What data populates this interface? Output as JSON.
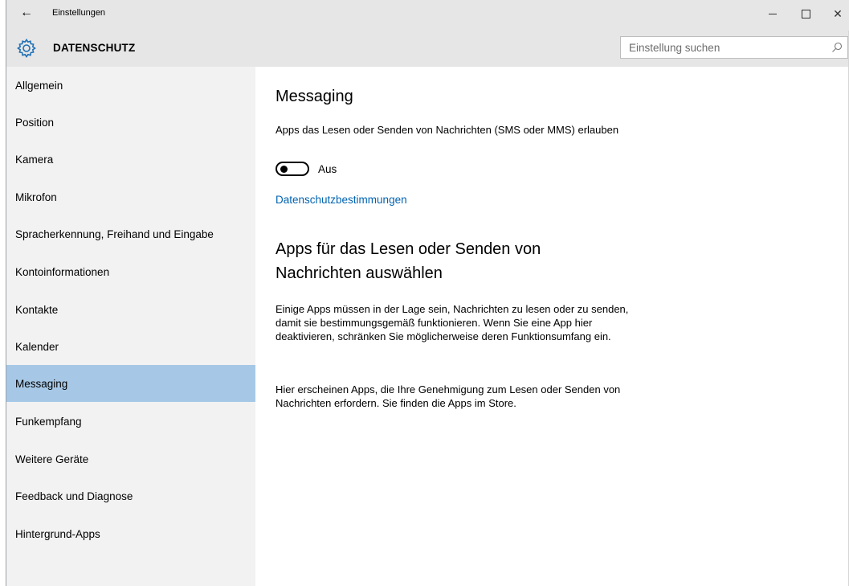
{
  "window": {
    "title": "Einstellungen",
    "back_icon": "arrow-left-icon",
    "controls": [
      "minimize-icon",
      "maximize-icon",
      "close-icon"
    ],
    "close_glyph": "✕",
    "back_glyph": "←"
  },
  "header": {
    "icon": "gear-icon",
    "title": "DATENSCHUTZ",
    "search": {
      "placeholder": "Einstellung suchen",
      "value": "",
      "icon": "search-icon"
    }
  },
  "sidebar": {
    "selected_index": 8,
    "items": [
      {
        "label": "Allgemein"
      },
      {
        "label": "Position"
      },
      {
        "label": "Kamera"
      },
      {
        "label": "Mikrofon"
      },
      {
        "label": "Spracherkennung, Freihand und Eingabe"
      },
      {
        "label": "Kontoinformationen"
      },
      {
        "label": "Kontakte"
      },
      {
        "label": "Kalender"
      },
      {
        "label": "Messaging"
      },
      {
        "label": "Funkempfang"
      },
      {
        "label": "Weitere Geräte"
      },
      {
        "label": "Feedback und Diagnose"
      },
      {
        "label": "Hintergrund-Apps"
      }
    ]
  },
  "main": {
    "heading": "Messaging",
    "toggle_description": "Apps das Lesen oder Senden von Nachrichten (SMS oder MMS) erlauben",
    "toggle_state": "Aus",
    "toggle_on": false,
    "privacy_link": "Datenschutzbestimmungen",
    "apps_heading": "Apps für das Lesen oder Senden von Nachrichten auswählen",
    "paragraph1": "Einige Apps müssen in der Lage sein, Nachrichten zu lesen oder zu senden, damit sie bestimmungsgemäß funktionieren. Wenn Sie eine App hier deaktivieren, schränken Sie möglicherweise deren Funktionsumfang ein.",
    "paragraph2": "Hier erscheinen Apps, die Ihre Genehmigung zum Lesen oder Senden von Nachrichten erfordern. Sie finden die Apps im Store."
  },
  "colors": {
    "titlebar_bg": "#e6e6e6",
    "sidebar_bg": "#f2f2f2",
    "selected_bg": "#a6c8e6",
    "link": "#0063b1"
  }
}
